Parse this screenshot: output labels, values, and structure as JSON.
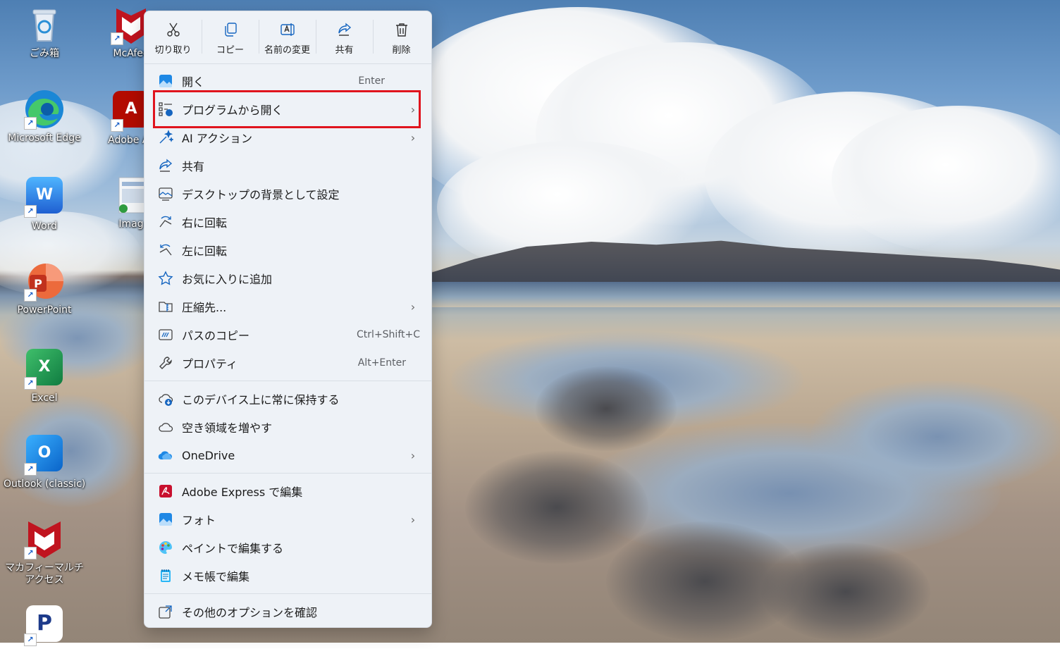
{
  "desktop": {
    "icons": [
      {
        "label": "ごみ箱",
        "icon": "recycle-bin-icon"
      },
      {
        "label": "McAfee",
        "icon": "mcafee-icon"
      },
      {
        "label": "Microsoft Edge",
        "icon": "edge-icon"
      },
      {
        "label": "Adobe Ac",
        "icon": "adobe-acrobat-icon"
      },
      {
        "label": "Word",
        "icon": "word-icon"
      },
      {
        "label": "Imag",
        "icon": "image-file-icon"
      },
      {
        "label": "PowerPoint",
        "icon": "powerpoint-icon"
      },
      {
        "label": "Excel",
        "icon": "excel-icon"
      },
      {
        "label": "Outlook (classic)",
        "icon": "outlook-icon"
      },
      {
        "label": "マカフィーマルチアクセス",
        "icon": "mcafee-multi-access-icon"
      },
      {
        "label": "",
        "icon": "paypal-icon"
      }
    ]
  },
  "context_menu": {
    "toolbar": [
      {
        "label": "切り取り",
        "icon": "scissors-icon"
      },
      {
        "label": "コピー",
        "icon": "copy-icon"
      },
      {
        "label": "名前の変更",
        "icon": "rename-icon"
      },
      {
        "label": "共有",
        "icon": "share-icon"
      },
      {
        "label": "削除",
        "icon": "trash-icon"
      }
    ],
    "items": [
      {
        "label": "開く",
        "shortcut": "Enter",
        "icon": "photo-icon"
      },
      {
        "label": "プログラムから開く",
        "icon": "open-with-icon",
        "submenu": true
      },
      {
        "label": "AI アクション",
        "icon": "ai-sparkle-icon",
        "submenu": true
      },
      {
        "label": "共有",
        "icon": "share-icon"
      },
      {
        "label": "デスクトップの背景として設定",
        "icon": "wallpaper-icon"
      },
      {
        "label": "右に回転",
        "icon": "rotate-right-icon"
      },
      {
        "label": "左に回転",
        "icon": "rotate-left-icon"
      },
      {
        "label": "お気に入りに追加",
        "icon": "star-icon"
      },
      {
        "label": "圧縮先...",
        "icon": "zip-folder-icon",
        "submenu": true
      },
      {
        "label": "パスのコピー",
        "shortcut": "Ctrl+Shift+C",
        "icon": "copy-path-icon"
      },
      {
        "label": "プロパティ",
        "shortcut": "Alt+Enter",
        "icon": "wrench-icon"
      },
      {
        "label": "このデバイス上に常に保持する",
        "icon": "cloud-download-icon"
      },
      {
        "label": "空き領域を増やす",
        "icon": "cloud-icon"
      },
      {
        "label": "OneDrive",
        "icon": "onedrive-icon",
        "submenu": true
      },
      {
        "label": "Adobe Express で編集",
        "icon": "adobe-express-icon"
      },
      {
        "label": "フォト",
        "icon": "photos-app-icon",
        "submenu": true
      },
      {
        "label": "ペイントで編集する",
        "icon": "paint-icon"
      },
      {
        "label": "メモ帳で編集",
        "icon": "notepad-icon"
      },
      {
        "label": "その他のオプションを確認",
        "icon": "more-options-icon"
      }
    ],
    "highlighted_item": "プログラムから開く",
    "highlight_color": "#e0141e"
  }
}
